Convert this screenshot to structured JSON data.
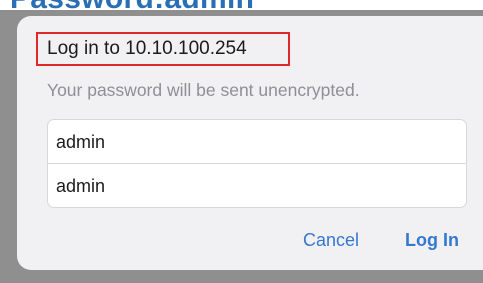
{
  "background": {
    "heading": "Password:admin"
  },
  "dialog": {
    "title": "Log in to 10.10.100.254",
    "message": "Your password will be sent unencrypted.",
    "username_value": "admin",
    "password_value": "admin",
    "cancel_label": "Cancel",
    "login_label": "Log In"
  },
  "colors": {
    "heading": "#2a6fb6",
    "highlight_box": "#e3262a",
    "button_text": "#3478d0",
    "dialog_bg": "#f1f1f3"
  }
}
